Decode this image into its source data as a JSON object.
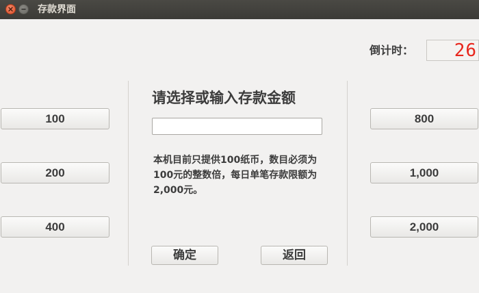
{
  "window": {
    "title": "存款界面"
  },
  "countdown": {
    "label": "倒计时：",
    "value": "26",
    "color": "#e8261c"
  },
  "main": {
    "prompt": "请选择或输入存款金额",
    "input_value": "",
    "notice": "本机目前只提供100纸币，数目必须为100元的整数倍，每日单笔存款限额为2,000元。",
    "confirm_label": "确定",
    "back_label": "返回"
  },
  "amounts": {
    "left": [
      "100",
      "200",
      "400"
    ],
    "right": [
      "800",
      "1,000",
      "2,000"
    ]
  }
}
